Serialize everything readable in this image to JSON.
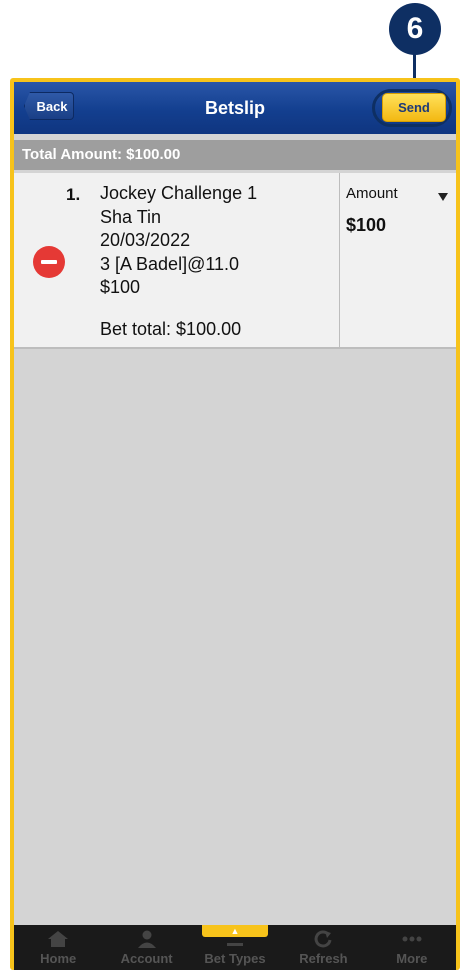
{
  "callout": {
    "number": "6"
  },
  "header": {
    "back_label": "Back",
    "title": "Betslip",
    "send_label": "Send"
  },
  "summary": {
    "total_text": "Total Amount: $100.00"
  },
  "bets": [
    {
      "index": "1.",
      "lines": [
        "Jockey Challenge 1",
        "Sha Tin",
        "20/03/2022",
        "3 [A Badel]@11.0",
        "$100"
      ],
      "bet_total": "Bet total: $100.00",
      "amount_label": "Amount",
      "amount_value": "$100"
    }
  ],
  "bottom_nav": {
    "items": [
      {
        "label": "Home",
        "icon": "home-icon"
      },
      {
        "label": "Account",
        "icon": "account-icon"
      },
      {
        "label": "Bet Types",
        "icon": "bet-types-icon"
      },
      {
        "label": "Refresh",
        "icon": "refresh-icon"
      },
      {
        "label": "More",
        "icon": "more-icon"
      }
    ]
  },
  "colors": {
    "frame_highlight": "#f7c31b",
    "header_blue": "#133f8f",
    "send_yellow": "#f3b812",
    "remove_red": "#e53935",
    "callout_navy": "#0e2f63"
  }
}
